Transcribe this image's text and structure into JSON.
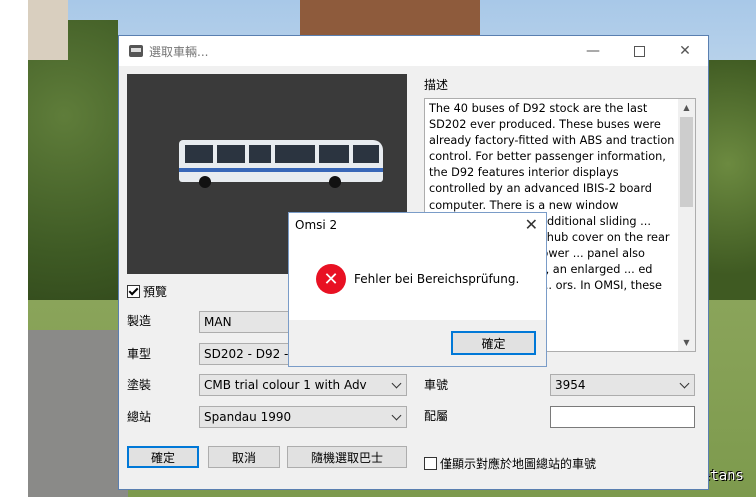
{
  "background": {
    "watermark": "@Wetans"
  },
  "window": {
    "title": "選取車輛...",
    "controls": {
      "minimize": "—",
      "close": "✕"
    }
  },
  "form": {
    "preview_label": "預覽",
    "preview_checked": true,
    "manufacturer_label": "製造",
    "manufacturer_value": "MAN",
    "model_label": "車型",
    "model_value": "SD202 - D92 - M",
    "livery_label": "塗裝",
    "livery_value": "CMB trial colour 1 with Adv",
    "depot_label": "總站",
    "depot_value": "Spandau 1990",
    "number_label": "車號",
    "number_value": "3954",
    "plate_label": "配屬",
    "plate_value": ""
  },
  "description": {
    "label": "描述",
    "text": "The 40 buses of D92 stock are the last SD202 ever produced. These buses were already factory-fitted with ABS and traction control. For better passenger information, the D92 features interior displays controlled by an advanced IBIS-2 board computer. There is a new window alignment in the ... additional sliding ... purposes. Further ... hub cover on the rear ... spotlights in the lower ... panel also features new ... light, an enlarged ... ed 20h-switch and the ... ors. In OMSI, these"
  },
  "buttons": {
    "ok": "確定",
    "cancel": "取消",
    "random": "隨機選取巴士"
  },
  "only_depot_label": "僅顯示對應於地圖總站的車號",
  "only_depot_checked": false,
  "dialog": {
    "title": "Omsi 2",
    "close": "✕",
    "icon": "✕",
    "message": "Fehler bei Bereichsprüfung.",
    "ok": "確定"
  }
}
